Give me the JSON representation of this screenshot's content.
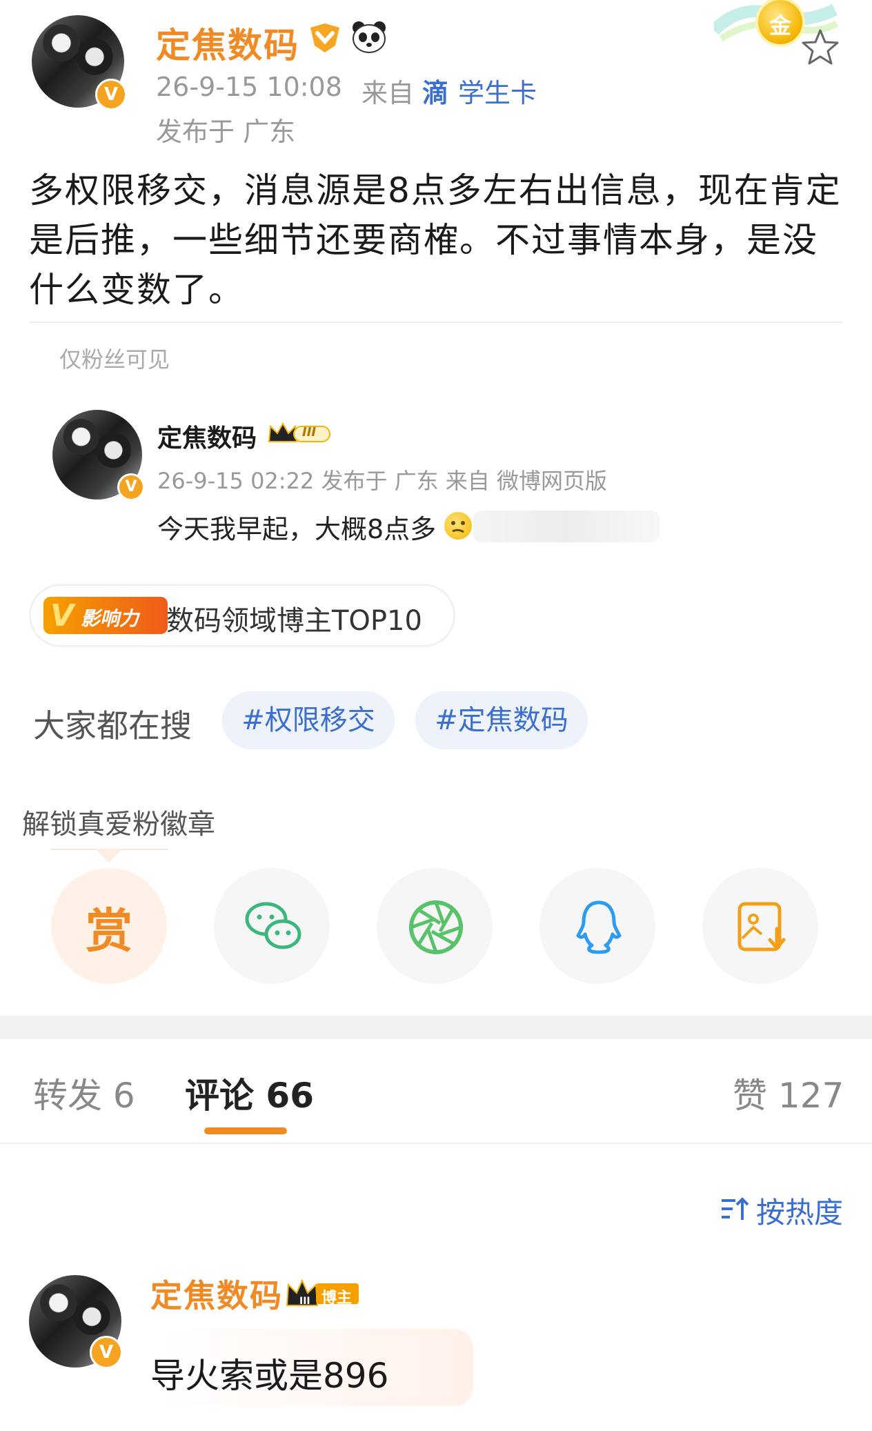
{
  "post": {
    "author": "定焦数码",
    "time": "26-9-15 10:08",
    "source_prefix": "来自",
    "source_icon": "滴",
    "source": "学生卡",
    "location": "发布于 广东",
    "text": "多权限移交，消息源是8点多左右出信息，现在肯定是后推，一些细节还要商榷。不过事情本身，是没什么变数了。",
    "medal_label": "金"
  },
  "visibility": "仅粉丝可见",
  "quoted": {
    "author": "定焦数码",
    "level": "III",
    "meta": "26-9-15 02:22 发布于 广东 来自 微博网页版",
    "text": "今天我早起，大概8点多"
  },
  "influence": {
    "badge_v": "V",
    "badge_text": "影响力",
    "label": "数码领域博主TOP10"
  },
  "search": {
    "label": "大家都在搜",
    "tags": [
      "#权限移交",
      "#定焦数码"
    ]
  },
  "unlock": "解锁真爱粉徽章",
  "share": {
    "reward_label": "赏",
    "icons": [
      "reward-icon",
      "wechat-icon",
      "moments-icon",
      "qq-icon",
      "save-image-icon"
    ]
  },
  "tabs": {
    "repost": "转发 6",
    "comment": "评论 66",
    "like": "赞 127"
  },
  "sort": "按热度",
  "comment": {
    "author": "定焦数码",
    "badge": "博主",
    "level": "III",
    "text": "导火索或是896"
  },
  "colors": {
    "accent": "#f08a24",
    "link": "#3a6fd0",
    "tab_indicator": "#f08a24"
  }
}
